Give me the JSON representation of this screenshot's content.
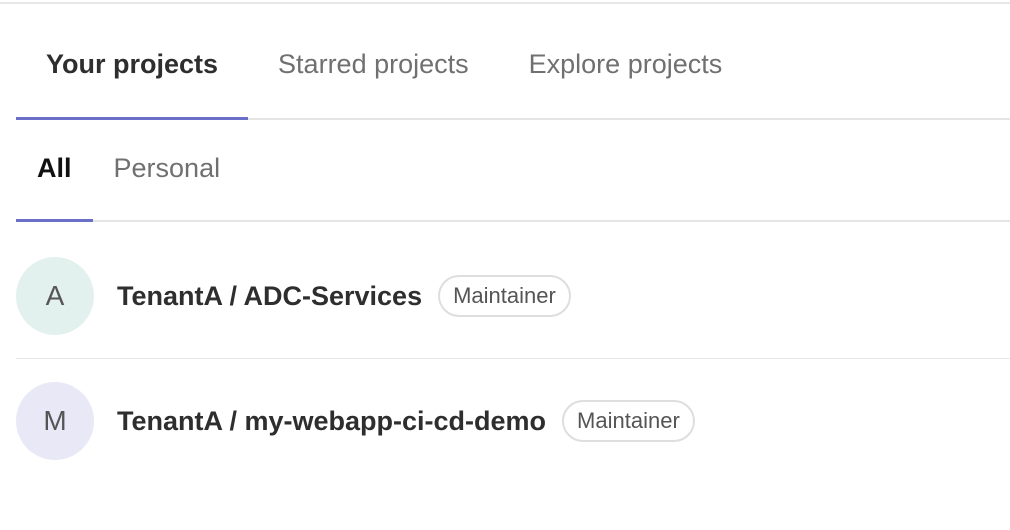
{
  "tabs": [
    {
      "label": "Your projects",
      "active": true
    },
    {
      "label": "Starred projects",
      "active": false
    },
    {
      "label": "Explore projects",
      "active": false
    }
  ],
  "subtabs": [
    {
      "label": "All",
      "active": true
    },
    {
      "label": "Personal",
      "active": false
    }
  ],
  "projects": [
    {
      "avatar_letter": "A",
      "avatar_color": "#e3f1ee",
      "name": "TenantA / ADC-Services",
      "role": "Maintainer"
    },
    {
      "avatar_letter": "M",
      "avatar_color": "#e8e8f7",
      "name": "TenantA / my-webapp-ci-cd-demo",
      "role": "Maintainer"
    }
  ],
  "colors": {
    "accent": "#6b6fc7",
    "border": "#e5e5e5"
  }
}
